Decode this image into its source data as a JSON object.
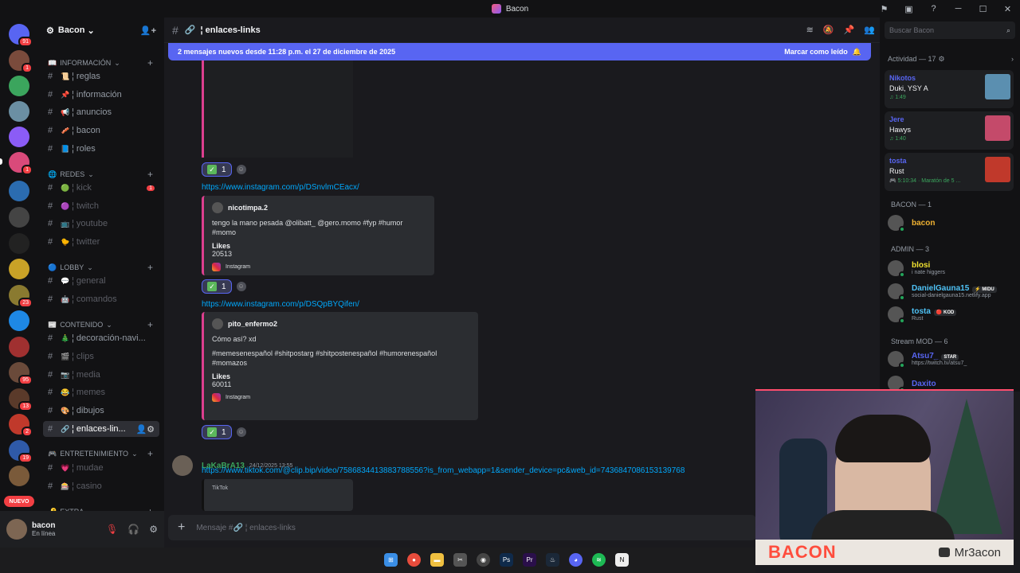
{
  "window": {
    "title": "Bacon"
  },
  "servers": [
    {
      "label": "",
      "badge": "91",
      "color": "#5865f2"
    },
    {
      "label": "",
      "badge": "1",
      "color": "#7a4b3c"
    },
    {
      "label": "",
      "badge": "",
      "color": "#3ba55d"
    },
    {
      "label": "",
      "badge": "",
      "color": "#6b8fa3"
    },
    {
      "label": "",
      "badge": "",
      "color": "#8b5cf6"
    },
    {
      "label": "",
      "badge": "1",
      "color": "#d94a7a"
    },
    {
      "label": "",
      "badge": "",
      "color": "#2b6cb0"
    },
    {
      "label": "",
      "badge": "",
      "color": "#444"
    },
    {
      "label": "",
      "badge": "",
      "color": "#222"
    },
    {
      "label": "",
      "badge": "",
      "color": "#c9a227"
    },
    {
      "label": "",
      "badge": "23",
      "color": "#8a7a30"
    },
    {
      "label": "",
      "badge": "",
      "color": "#1e88e5"
    },
    {
      "label": "",
      "badge": "",
      "color": "#a03030"
    },
    {
      "label": "",
      "badge": "95",
      "color": "#6a4a3a"
    },
    {
      "label": "",
      "badge": "13",
      "color": "#5a3a2a"
    },
    {
      "label": "",
      "badge": "2",
      "color": "#c0392b"
    },
    {
      "label": "",
      "badge": "19",
      "color": "#2f5aa8"
    },
    {
      "label": "",
      "badge": "",
      "color": "#7a5a3a"
    }
  ],
  "new_label": "NUEVO",
  "guild": {
    "name": "Bacon"
  },
  "categories": [
    {
      "name": "INFORMACIÓN",
      "emoji": "📖"
    },
    {
      "name": "REDES",
      "emoji": "🌐"
    },
    {
      "name": "LOBBY",
      "emoji": "🔵"
    },
    {
      "name": "CONTENIDO",
      "emoji": "📰"
    },
    {
      "name": "ENTRETENIMIENTO",
      "emoji": "🎮"
    },
    {
      "name": "EXTRA",
      "emoji": "🔑"
    }
  ],
  "channels": [
    {
      "label": "reglas",
      "emoji": "📜",
      "dim": false
    },
    {
      "label": "información",
      "emoji": "📌",
      "dim": false
    },
    {
      "label": "anuncios",
      "emoji": "📢",
      "dim": false
    },
    {
      "label": "bacon",
      "emoji": "🥓",
      "dim": false
    },
    {
      "label": "roles",
      "emoji": "📘",
      "dim": false
    },
    {
      "label": "kick",
      "emoji": "🟢",
      "dim": true,
      "badge": "1"
    },
    {
      "label": "twitch",
      "emoji": "🟣",
      "dim": true
    },
    {
      "label": "youtube",
      "emoji": "📺",
      "dim": true
    },
    {
      "label": "twitter",
      "emoji": "🐤",
      "dim": true
    },
    {
      "label": "general",
      "emoji": "💬",
      "dim": true
    },
    {
      "label": "comandos",
      "emoji": "🤖",
      "dim": true
    },
    {
      "label": "decoración-navi...",
      "emoji": "🎄",
      "dim": false
    },
    {
      "label": "clips",
      "emoji": "🎬",
      "dim": true
    },
    {
      "label": "media",
      "emoji": "📷",
      "dim": true
    },
    {
      "label": "memes",
      "emoji": "😂",
      "dim": true
    },
    {
      "label": "dibujos",
      "emoji": "🎨",
      "dim": false
    },
    {
      "label": "enlaces-lin...",
      "emoji": "🔗",
      "dim": false,
      "selected": true
    },
    {
      "label": "mudae",
      "emoji": "💗",
      "dim": true
    },
    {
      "label": "casino",
      "emoji": "🎰",
      "dim": true
    }
  ],
  "user": {
    "name": "bacon",
    "status": "En línea"
  },
  "header": {
    "channel": "¦ enlaces-links"
  },
  "banner": {
    "text": "2 mensajes nuevos desde 11:28 p.m. el 27 de diciembre de 2025",
    "action": "Marcar como leído"
  },
  "messages": {
    "reaction_count": "1",
    "link1": "https://www.instagram.com/p/DSnvlmCEacx/",
    "embed1": {
      "author": "nicotimpa.2",
      "desc": "tengo la mano pesada @olibatt_ @gero.momo #fyp #humor #momo",
      "field": "Likes",
      "value": "20513",
      "footer": "Instagram"
    },
    "link2": "https://www.instagram.com/p/DSQpBYQifen/",
    "embed2": {
      "author": "pito_enfermo2",
      "desc1": "Cómo así? xd",
      "desc2": "#memesenespañol #shitpostarg #shitpostenespañol #humorenespañol #momazos",
      "field": "Likes",
      "value": "60011",
      "footer": "Instagram"
    },
    "author3": "LaKaBrA13",
    "date3": "24/12/2025 13:55",
    "link3": "https://www.tiktok.com/@clip.bip/video/7586834413883788556?is_from_webapp=1&sender_device=pc&web_id=7436847086153139768",
    "tiktok": "TikTok"
  },
  "composer": {
    "placeholder": "Mensaje #🔗 ¦ enlaces-links"
  },
  "right": {
    "search_placeholder": "Buscar Bacon",
    "activity_header": "Actividad — 17",
    "activities": [
      {
        "name": "Nikotos",
        "song": "Duki, YSY A",
        "time": "♫ 1:49",
        "color": "#5b8fb0"
      },
      {
        "name": "Jere",
        "song": "Hawys",
        "time": "♫ 1:40",
        "color": "#c44a6a"
      },
      {
        "name": "tosta",
        "song": "Rust",
        "time": "🎮 5:10:34 · Maratón de 5 ...",
        "color": "#c0392b"
      }
    ],
    "groups": [
      "BACON — 1",
      "ADMIN — 3",
      "Stream MOD — 6"
    ],
    "members": [
      {
        "name": "bacon",
        "sub": "",
        "color": "#f0b232",
        "tag": ""
      },
      {
        "name": "blosi",
        "sub": "i nate higgers",
        "color": "#f0e130",
        "tag": ""
      },
      {
        "name": "DanielGauna15",
        "sub": "social-danielgauna15.netlify.app",
        "color": "#4fc3f7",
        "tag": "⚡ MIDU"
      },
      {
        "name": "tosta",
        "sub": "Rust",
        "color": "#4fc3f7",
        "tag": "🔴 KOD"
      },
      {
        "name": "Atsu7_",
        "sub": "https://twitch.tv/atsu7_",
        "color": "#5865f2",
        "tag": "STAR"
      },
      {
        "name": "Daxito",
        "sub": "",
        "color": "#5865f2",
        "tag": ""
      }
    ]
  },
  "webcam": {
    "brand": "BACON",
    "channel": "Mr3acon"
  }
}
